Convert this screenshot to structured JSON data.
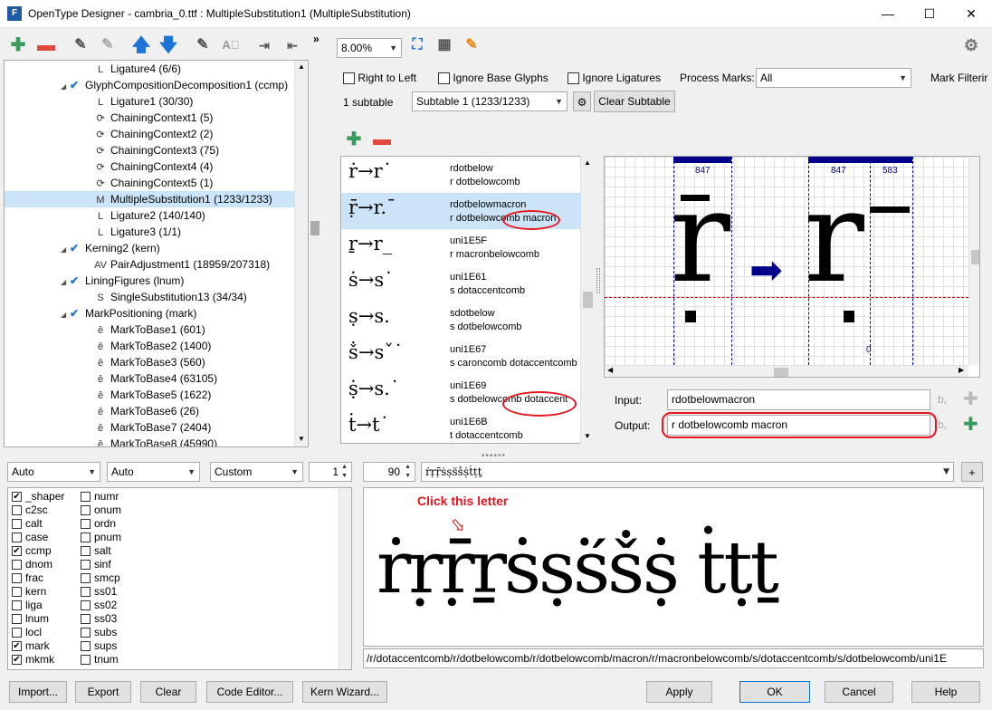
{
  "window": {
    "title": "OpenType Designer - cambria_0.ttf : MultipleSubstitution1 (MultipleSubstitution)",
    "app_icon": "F"
  },
  "tree": {
    "items": [
      {
        "label": "Ligature4 (6/6)",
        "icon": "ligature-icon",
        "level": 2
      },
      {
        "label": "GlyphCompositionDecomposition1 (ccmp)",
        "icon": "feature-check-icon",
        "level": 1
      },
      {
        "label": "Ligature1 (30/30)",
        "icon": "ligature-icon",
        "level": 2
      },
      {
        "label": "ChainingContext1 (5)",
        "icon": "chaining-icon",
        "level": 2
      },
      {
        "label": "ChainingContext2 (2)",
        "icon": "chaining-icon",
        "level": 2
      },
      {
        "label": "ChainingContext3 (75)",
        "icon": "chaining-icon",
        "level": 2
      },
      {
        "label": "ChainingContext4 (4)",
        "icon": "chaining-icon",
        "level": 2
      },
      {
        "label": "ChainingContext5 (1)",
        "icon": "chaining-icon",
        "level": 2
      },
      {
        "label": "MultipleSubstitution1 (1233/1233)",
        "icon": "multiple-icon",
        "level": 2,
        "selected": true
      },
      {
        "label": "Ligature2 (140/140)",
        "icon": "ligature-icon",
        "level": 2
      },
      {
        "label": "Ligature3 (1/1)",
        "icon": "ligature-icon",
        "level": 2
      },
      {
        "label": "Kerning2 (kern)",
        "icon": "feature-check-icon",
        "level": 1
      },
      {
        "label": "PairAdjustment1 (18959/207318)",
        "icon": "pair-icon",
        "level": 2
      },
      {
        "label": "LiningFigures (lnum)",
        "icon": "feature-check-icon",
        "level": 1
      },
      {
        "label": "SingleSubstitution13 (34/34)",
        "icon": "single-icon",
        "level": 2
      },
      {
        "label": "MarkPositioning (mark)",
        "icon": "feature-check-icon",
        "level": 1
      },
      {
        "label": "MarkToBase1 (601)",
        "icon": "mark-icon",
        "level": 2
      },
      {
        "label": "MarkToBase2 (1400)",
        "icon": "mark-icon",
        "level": 2
      },
      {
        "label": "MarkToBase3 (560)",
        "icon": "mark-icon",
        "level": 2
      },
      {
        "label": "MarkToBase4 (63105)",
        "icon": "mark-icon",
        "level": 2
      },
      {
        "label": "MarkToBase5 (1622)",
        "icon": "mark-icon",
        "level": 2
      },
      {
        "label": "MarkToBase6 (26)",
        "icon": "mark-icon",
        "level": 2
      },
      {
        "label": "MarkToBase7 (2404)",
        "icon": "mark-icon",
        "level": 2
      },
      {
        "label": "MarkToBase8 (45990)",
        "icon": "mark-icon",
        "level": 2
      }
    ]
  },
  "zoom": "8.00%",
  "options": {
    "right_to_left": "Right to Left",
    "ignore_base_glyphs": "Ignore Base Glyphs",
    "ignore_ligatures": "Ignore Ligatures",
    "process_marks_label": "Process Marks:",
    "process_marks_value": "All",
    "mark_filtering": "Mark Filterir"
  },
  "subtable": {
    "count": "1 subtable",
    "selected": "Subtable 1 (1233/1233)",
    "clear": "Clear Subtable"
  },
  "substitutions": [
    {
      "glyphs": "ṙ→r˙",
      "name": "rdotbelow",
      "out": "r dotbelowcomb"
    },
    {
      "glyphs": "ṝ→r.¯",
      "name": "rdotbelowmacron",
      "out": "r dotbelowcomb macron",
      "selected": true
    },
    {
      "glyphs": "ṟ→r_",
      "name": "uni1E5F",
      "out": "r macronbelowcomb"
    },
    {
      "glyphs": "ṡ→s˙",
      "name": "uni1E61",
      "out": "s dotaccentcomb"
    },
    {
      "glyphs": "ṣ→s.",
      "name": "sdotbelow",
      "out": "s dotbelowcomb"
    },
    {
      "glyphs": "ṧ→sˇ˙",
      "name": "uni1E67",
      "out": "s caroncomb dotaccentcomb"
    },
    {
      "glyphs": "ṩ→s.˙",
      "name": "uni1E69",
      "out": "s dotbelowcomb dotaccent"
    },
    {
      "glyphs": "ṫ→t˙",
      "name": "uni1E6B",
      "out": "t dotaccentcomb"
    }
  ],
  "preview": {
    "metric1": "847",
    "metric2": "847",
    "metric3": "583",
    "baseline_zero": "0",
    "glyph_in": "r",
    "glyph_out": "r"
  },
  "io": {
    "input_label": "Input:",
    "input_value": "rdotbelowmacron",
    "output_label": "Output:",
    "output_value": "r dotbelowcomb macron"
  },
  "bottom_controls": {
    "script": "Auto",
    "language": "Auto",
    "mode": "Custom",
    "count": "1",
    "size": "90",
    "text": "ṙṛṝṡṣṥṧṩṫṭṯ"
  },
  "features_col1": [
    {
      "tag": "_shaper",
      "checked": true
    },
    {
      "tag": "c2sc",
      "checked": false
    },
    {
      "tag": "calt",
      "checked": false
    },
    {
      "tag": "case",
      "checked": false
    },
    {
      "tag": "ccmp",
      "checked": true
    },
    {
      "tag": "dnom",
      "checked": false
    },
    {
      "tag": "frac",
      "checked": false
    },
    {
      "tag": "kern",
      "checked": false
    },
    {
      "tag": "liga",
      "checked": false
    },
    {
      "tag": "lnum",
      "checked": false
    },
    {
      "tag": "locl",
      "checked": false
    },
    {
      "tag": "mark",
      "checked": true
    },
    {
      "tag": "mkmk",
      "checked": true
    }
  ],
  "features_col2": [
    {
      "tag": "numr",
      "checked": false
    },
    {
      "tag": "onum",
      "checked": false
    },
    {
      "tag": "ordn",
      "checked": false
    },
    {
      "tag": "pnum",
      "checked": false
    },
    {
      "tag": "salt",
      "checked": false
    },
    {
      "tag": "sinf",
      "checked": false
    },
    {
      "tag": "smcp",
      "checked": false
    },
    {
      "tag": "ss01",
      "checked": false
    },
    {
      "tag": "ss02",
      "checked": false
    },
    {
      "tag": "ss03",
      "checked": false
    },
    {
      "tag": "subs",
      "checked": false
    },
    {
      "tag": "sups",
      "checked": false
    },
    {
      "tag": "tnum",
      "checked": false
    }
  ],
  "sample": {
    "annotation": "Click this letter",
    "text": "ṙṛṝṟṡṣṥṧṩ ṫṭṯ",
    "glyph_path": "/r/dotaccentcomb/r/dotbelowcomb/r/dotbelowcomb/macron/r/macronbelowcomb/s/dotaccentcomb/s/dotbelowcomb/uni1E"
  },
  "buttons": {
    "import": "Import...",
    "export": "Export",
    "clear": "Clear",
    "code_editor": "Code Editor...",
    "kern_wizard": "Kern Wizard...",
    "apply": "Apply",
    "ok": "OK",
    "cancel": "Cancel",
    "help": "Help"
  },
  "colors": {
    "accent_green": "#3a9b5c",
    "accent_red": "#e04a3c",
    "arrow_blue": "#1c74d6",
    "highlight": "#cce4f7",
    "annotation_red": "#e8141e",
    "metric_navy": "#00008b"
  }
}
